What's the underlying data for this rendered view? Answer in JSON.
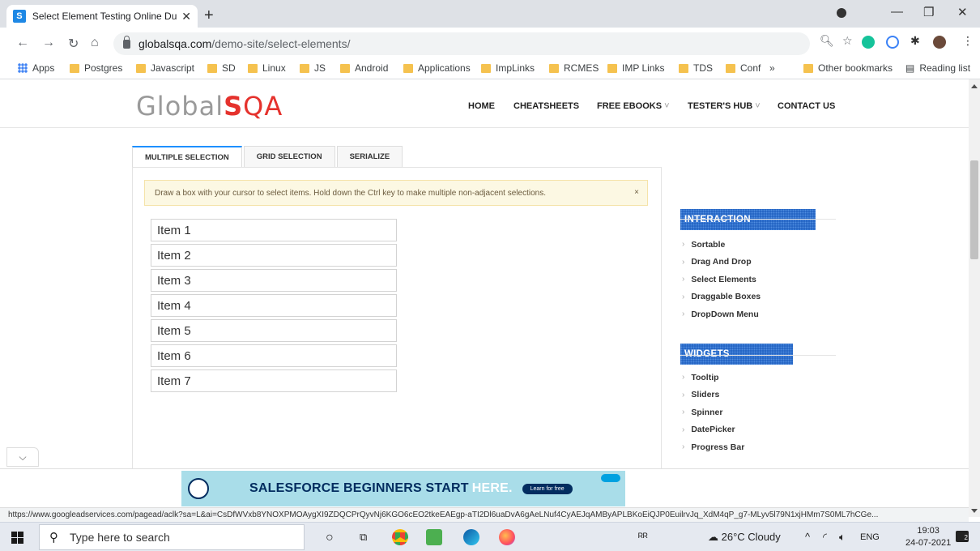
{
  "browser": {
    "tab_title": "Select Element Testing Online Du",
    "favicon_letter": "S",
    "url_host": "globalsqa.com",
    "url_path": "/demo-site/select-elements/"
  },
  "bookmarks": [
    "Apps",
    "Postgres",
    "Javascript",
    "SD",
    "Linux",
    "JS",
    "Android",
    "Applications",
    "ImpLinks",
    "RCMES",
    "IMP Links",
    "TDS",
    "Conf",
    "»",
    "Other bookmarks",
    "Reading list"
  ],
  "site": {
    "logo_part1": "Global",
    "logo_s": "S",
    "logo_qa": "QA",
    "nav": [
      {
        "label": "HOME",
        "caret": ""
      },
      {
        "label": "CHEATSHEETS",
        "caret": ""
      },
      {
        "label": "FREE EBOOKS",
        "caret": "˅"
      },
      {
        "label": "TESTER'S HUB",
        "caret": "˅"
      },
      {
        "label": "CONTACT US",
        "caret": ""
      }
    ]
  },
  "tabs": [
    "MULTIPLE SELECTION",
    "GRID SELECTION",
    "SERIALIZE"
  ],
  "notice": {
    "text": "Draw a box with your cursor to select items. Hold down the Ctrl key to make multiple non-adjacent selections.",
    "close": "×"
  },
  "items": [
    "Item 1",
    "Item 2",
    "Item 3",
    "Item 4",
    "Item 5",
    "Item 6",
    "Item 7"
  ],
  "sidebar": {
    "interaction_title": "INTERACTION",
    "interaction": [
      "Sortable",
      "Drag And Drop",
      "Select Elements",
      "Draggable Boxes",
      "DropDown Menu"
    ],
    "widgets_title": "WIDGETS",
    "widgets": [
      "Tooltip",
      "Sliders",
      "Spinner",
      "DatePicker",
      "Progress Bar"
    ]
  },
  "ad": {
    "text": "SALESFORCE BEGINNERS START",
    "highlight": "HERE.",
    "button": "Learn for free"
  },
  "status_url": "https://www.googleadservices.com/pagead/aclk?sa=L&ai=CsDfWVxb8YNOXPMOAygXI9ZDQCPrQyvNj6KGO6cEO2tkeEAEgp-aTI2Dl6uaDvA6gAeLNuf4CyAEJqAMByAPLBKoEiQJP0EuilrvJq_XdM4qP_g7-MLyv5l79N1xjHMm7S0ML7hCGe...",
  "taskbar": {
    "search_placeholder": "Type here to search",
    "weather": "26°C  Cloudy",
    "lang": "ENG",
    "time": "19:03",
    "date": "24-07-2021",
    "notif_count": "2"
  }
}
